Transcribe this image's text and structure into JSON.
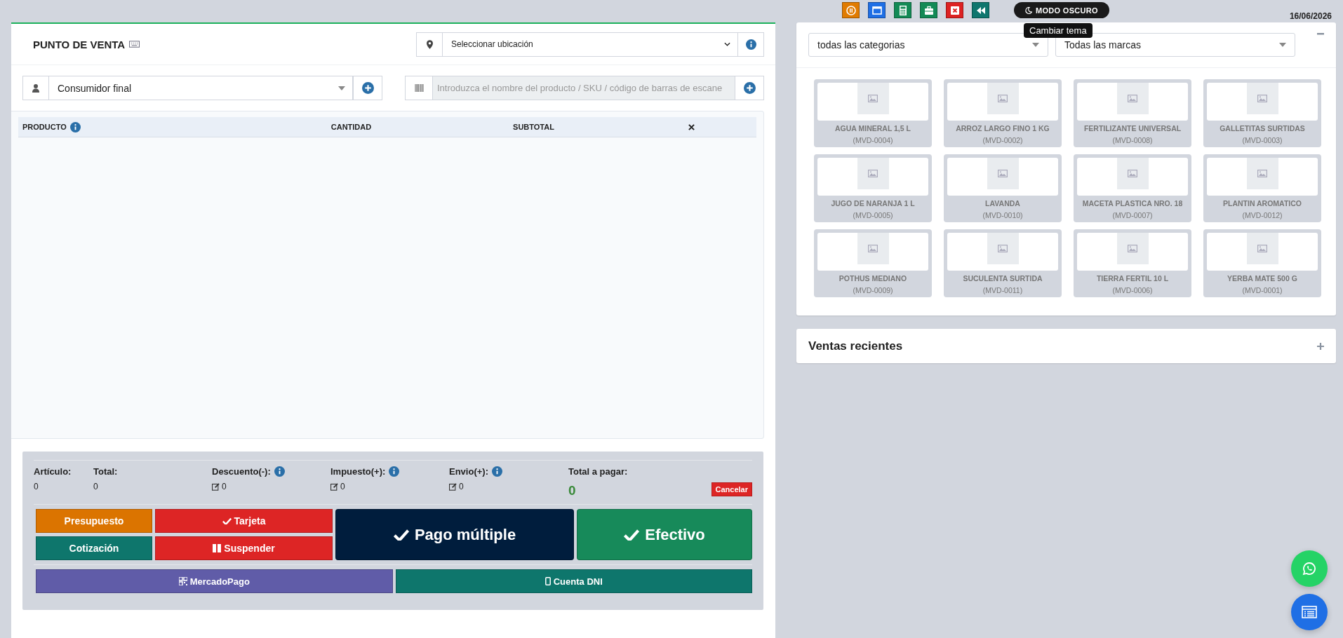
{
  "toolbar": {
    "buttons": [
      {
        "kind": "pause"
      },
      {
        "kind": "window"
      },
      {
        "kind": "calculator"
      },
      {
        "kind": "briefcase"
      },
      {
        "kind": "close"
      },
      {
        "kind": "rewind"
      }
    ],
    "theme_toggle": {
      "label": "MODO OSCURO",
      "tooltip": "Cambiar tema"
    },
    "date": "16/06/2026"
  },
  "pos": {
    "title": "PUNTO DE VENTA",
    "location_select": {
      "value": "Seleccionar ubicación"
    },
    "customer_select": {
      "value": "Consumidor final"
    },
    "product_search": {
      "placeholder": "Introduzca el nombre del producto / SKU / código de barras de escane"
    },
    "table": {
      "columns": [
        "PRODUCTO",
        "CANTIDAD",
        "SUBTOTAL"
      ]
    },
    "summary": [
      {
        "kind": "plain",
        "label": "Artículo:",
        "value": "0"
      },
      {
        "kind": "plain",
        "label": "Total:",
        "value": "0"
      },
      {
        "kind": "editable",
        "label": "Descuento(-):",
        "value": "0"
      },
      {
        "kind": "editable",
        "label": "Impuesto(+):",
        "value": "0"
      },
      {
        "kind": "editable",
        "label": "Envio(+):",
        "value": "0"
      }
    ],
    "total_to_pay": {
      "label": "Total a pagar:",
      "value": "0"
    },
    "cancel": "Cancelar",
    "actions": [
      {
        "kind": "small",
        "label": "Presupuesto"
      },
      {
        "kind": "small",
        "label": "Tarjeta"
      },
      {
        "kind": "large",
        "label": "Pago múltiple"
      },
      {
        "kind": "large",
        "label": "Efectivo"
      },
      {
        "kind": "small",
        "label": "Cotización"
      },
      {
        "kind": "small",
        "label": "Suspender"
      }
    ],
    "payments": [
      {
        "label": "MercadoPago"
      },
      {
        "label": "Cuenta DNI"
      }
    ]
  },
  "catalog": {
    "category_select": {
      "value": "todas las categorias"
    },
    "brand_select": {
      "value": "Todas las marcas"
    },
    "products": [
      {
        "name": "AGUA MINERAL 1,5 L",
        "sku": "(MVD-0004)"
      },
      {
        "name": "ARROZ LARGO FINO 1 KG",
        "sku": "(MVD-0002)"
      },
      {
        "name": "FERTILIZANTE UNIVERSAL",
        "sku": "(MVD-0008)"
      },
      {
        "name": "GALLETITAS SURTIDAS",
        "sku": "(MVD-0003)"
      },
      {
        "name": "JUGO DE NARANJA 1 L",
        "sku": "(MVD-0005)"
      },
      {
        "name": "LAVANDA",
        "sku": "(MVD-0010)"
      },
      {
        "name": "MACETA PLASTICA NRO. 18",
        "sku": "(MVD-0007)"
      },
      {
        "name": "PLANTIN AROMATICO",
        "sku": "(MVD-0012)"
      },
      {
        "name": "POTHUS MEDIANO",
        "sku": "(MVD-0009)"
      },
      {
        "name": "SUCULENTA SURTIDA",
        "sku": "(MVD-0011)"
      },
      {
        "name": "TIERRA FERTIL 10 L",
        "sku": "(MVD-0006)"
      },
      {
        "name": "YERBA MATE 500 G",
        "sku": "(MVD-0001)"
      }
    ]
  },
  "recent_sales": {
    "title": "Ventas recientes"
  }
}
